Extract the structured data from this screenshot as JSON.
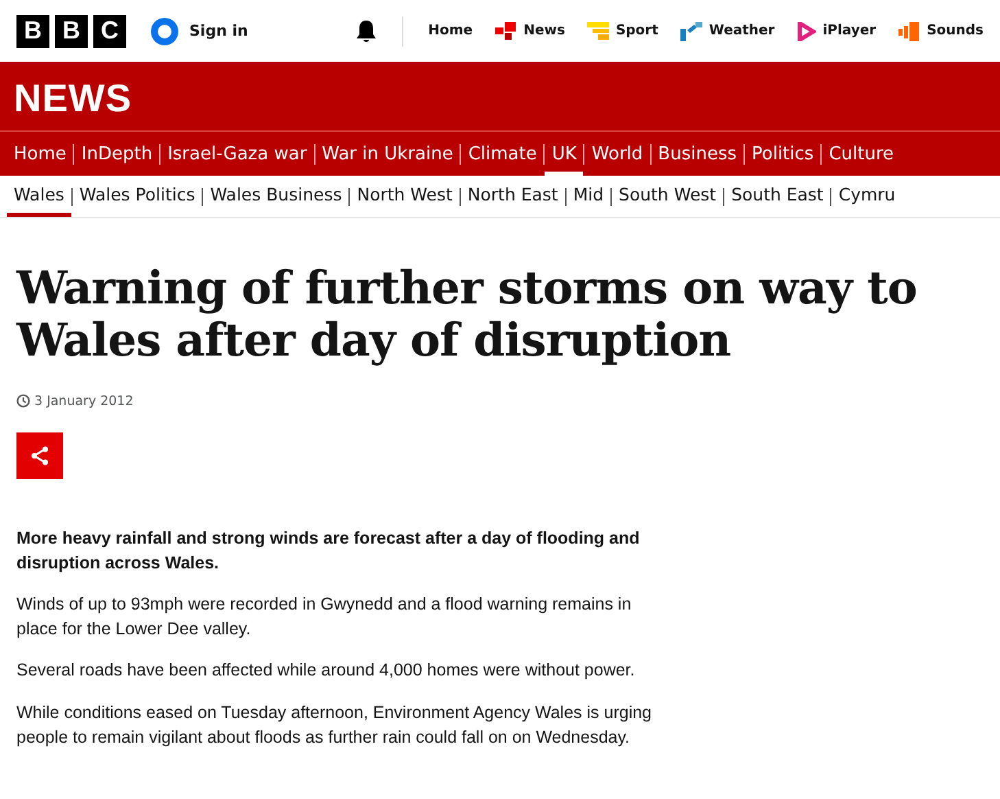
{
  "header": {
    "logo": [
      "B",
      "B",
      "C"
    ],
    "sign_in": "Sign in",
    "links": [
      {
        "label": "Home"
      },
      {
        "label": "News"
      },
      {
        "label": "Sport"
      },
      {
        "label": "Weather"
      },
      {
        "label": "iPlayer"
      },
      {
        "label": "Sounds"
      }
    ]
  },
  "section_title": "NEWS",
  "main_nav": [
    {
      "label": "Home",
      "selected": false
    },
    {
      "label": "InDepth",
      "selected": false
    },
    {
      "label": "Israel-Gaza war",
      "selected": false
    },
    {
      "label": "War in Ukraine",
      "selected": false
    },
    {
      "label": "Climate",
      "selected": false
    },
    {
      "label": "UK",
      "selected": true
    },
    {
      "label": "World",
      "selected": false
    },
    {
      "label": "Business",
      "selected": false
    },
    {
      "label": "Politics",
      "selected": false
    },
    {
      "label": "Culture",
      "selected": false
    }
  ],
  "sub_nav": [
    {
      "label": "Wales",
      "selected": true
    },
    {
      "label": "Wales Politics",
      "selected": false
    },
    {
      "label": "Wales Business",
      "selected": false
    },
    {
      "label": "North West",
      "selected": false
    },
    {
      "label": "North East",
      "selected": false
    },
    {
      "label": "Mid",
      "selected": false
    },
    {
      "label": "South West",
      "selected": false
    },
    {
      "label": "South East",
      "selected": false
    },
    {
      "label": "Cymru",
      "selected": false
    }
  ],
  "article": {
    "headline": "Warning of further storms on way to Wales after day of disruption",
    "date": "3 January 2012",
    "paragraphs": [
      {
        "kind": "lead",
        "text": "More heavy rainfall and strong winds are forecast after a day of flooding and disruption across Wales."
      },
      {
        "kind": "body",
        "text": "Winds of up to 93mph were recorded in Gwynedd and a flood warning remains in place for the Lower Dee valley."
      },
      {
        "kind": "body",
        "text": "Several roads have been affected while around 4,000 homes were without power."
      },
      {
        "kind": "body",
        "text": "While conditions eased on Tuesday afternoon, Environment Agency Wales is urging people to remain vigilant about floods as further rain could fall on on Wednesday."
      }
    ]
  }
}
